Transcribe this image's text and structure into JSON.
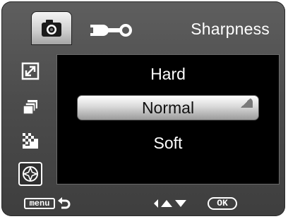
{
  "header": {
    "title": "Sharpness",
    "tabs": [
      {
        "icon": "camera-icon",
        "selected": true
      },
      {
        "icon": "wrench-icon",
        "selected": false
      }
    ]
  },
  "sidebar": {
    "items": [
      {
        "icon": "resolution-icon",
        "selected": false
      },
      {
        "icon": "copies-icon",
        "selected": false
      },
      {
        "icon": "quality-icon",
        "selected": false
      },
      {
        "icon": "sharpness-icon",
        "selected": true
      }
    ]
  },
  "options": {
    "items": [
      "Hard",
      "Normal",
      "Soft"
    ],
    "selected": "Normal"
  },
  "footer": {
    "menu_label": "menu",
    "ok_label": "OK"
  },
  "colors": {
    "accent_selected": "#d9d9d9",
    "panel_background": "#000000",
    "bezel": "#4c4c4c",
    "text": "#ffffff"
  }
}
